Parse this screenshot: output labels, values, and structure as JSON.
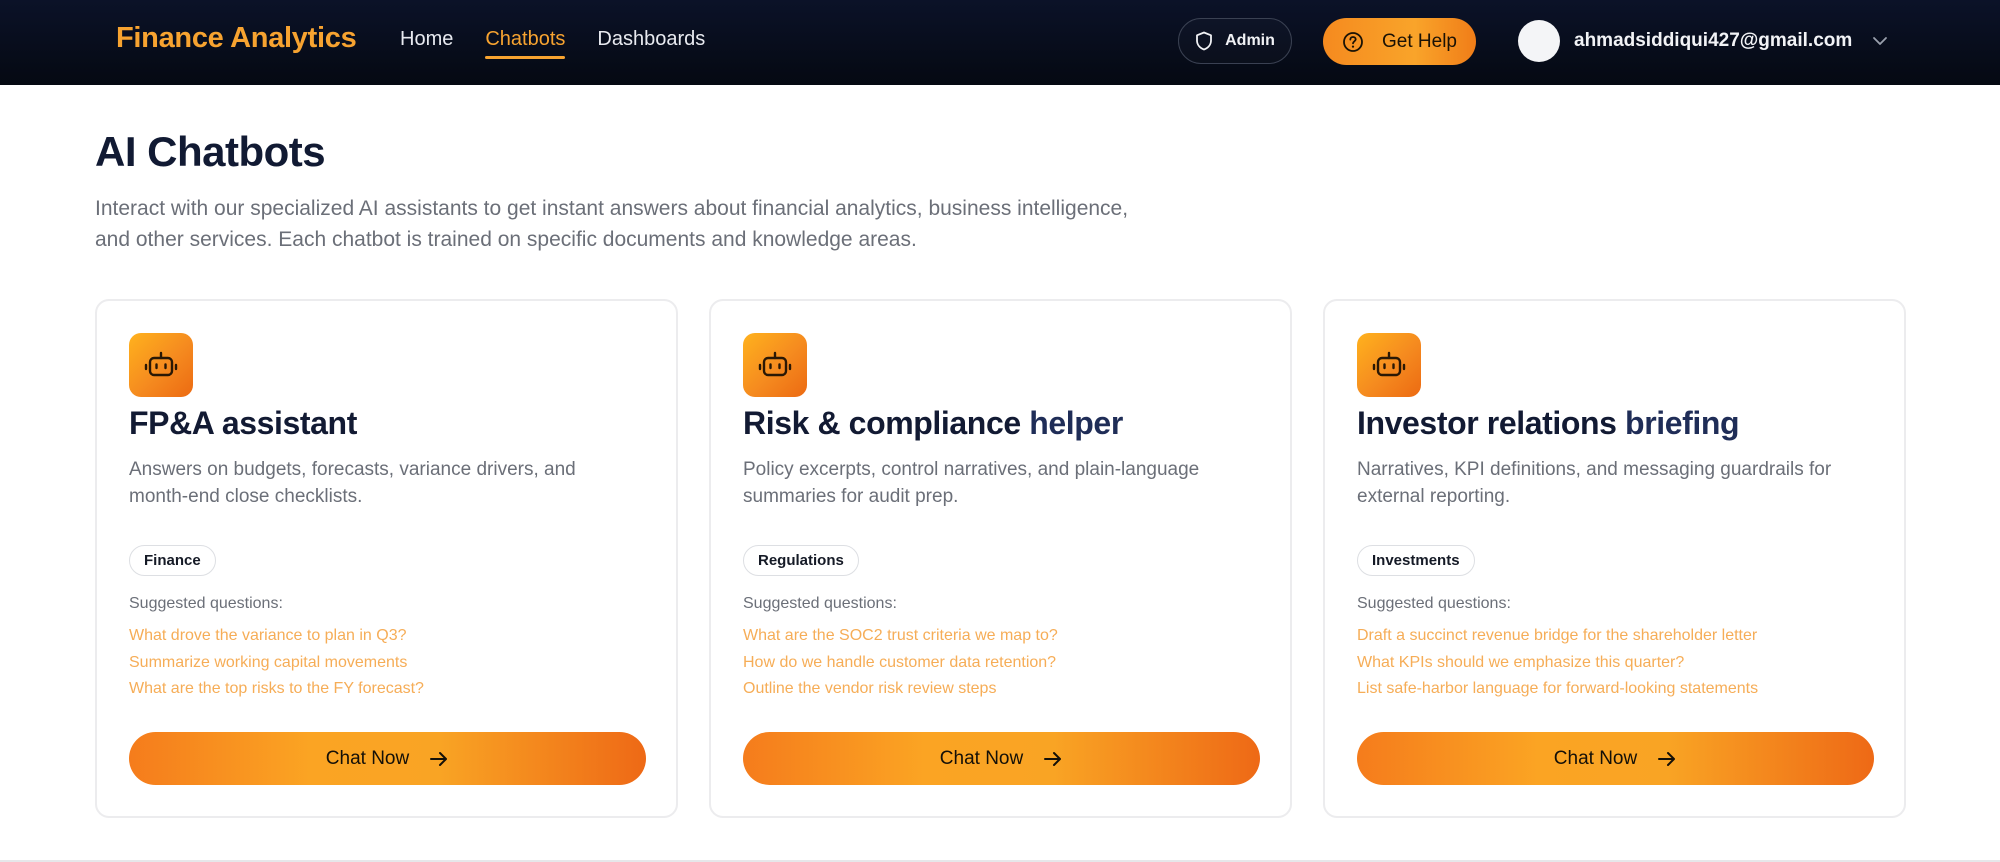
{
  "navbar": {
    "brand": "Finance Analytics",
    "links": [
      "Home",
      "Chatbots",
      "Dashboards"
    ],
    "active_link": "Chatbots",
    "admin_label": "Admin",
    "help_label": "Get Help",
    "user_email": "ahmadsiddiqui427@gmail.com"
  },
  "page": {
    "title": "AI Chatbots",
    "description": "Interact with our specialized AI assistants to get instant answers about financial analytics, business intelligence, and other services. Each chatbot is trained on specific documents and knowledge areas."
  },
  "cards": [
    {
      "title_main": "FP&A assistant",
      "title_highlight": "",
      "description": "Answers on budgets, forecasts, variance drivers, and month-end close checklists.",
      "tag": "Finance",
      "suggested_label": "Suggested questions:",
      "questions": [
        "What drove the variance to plan in Q3?",
        "Summarize working capital movements",
        "What are the top risks to the FY forecast?"
      ],
      "button_label": "Chat Now"
    },
    {
      "title_main": "Risk & compliance ",
      "title_highlight": "helper",
      "description": "Policy excerpts, control narratives, and plain-language summaries for audit prep.",
      "tag": "Regulations",
      "suggested_label": "Suggested questions:",
      "questions": [
        "What are the SOC2 trust criteria we map to?",
        "How do we handle customer data retention?",
        "Outline the vendor risk review steps"
      ],
      "button_label": "Chat Now"
    },
    {
      "title_main": "Investor relations ",
      "title_highlight": "briefing",
      "description": "Narratives, KPI definitions, and messaging guardrails for external reporting.",
      "tag": "Investments",
      "suggested_label": "Suggested questions:",
      "questions": [
        "Draft a succinct revenue bridge for the shareholder letter",
        "What KPIs should we emphasize this quarter?",
        "List safe-harbor language for forward-looking statements"
      ],
      "button_label": "Chat Now"
    }
  ],
  "colors": {
    "accent": "#f7a330",
    "navbar_bg": "#0b1228",
    "title": "#111a33",
    "question_link": "#f6ad57"
  },
  "icons": {
    "admin": "shield-icon",
    "help": "question-circle-icon",
    "user_menu": "chevron-down-icon",
    "card": "robot-icon",
    "chat": "arrow-right-icon"
  }
}
